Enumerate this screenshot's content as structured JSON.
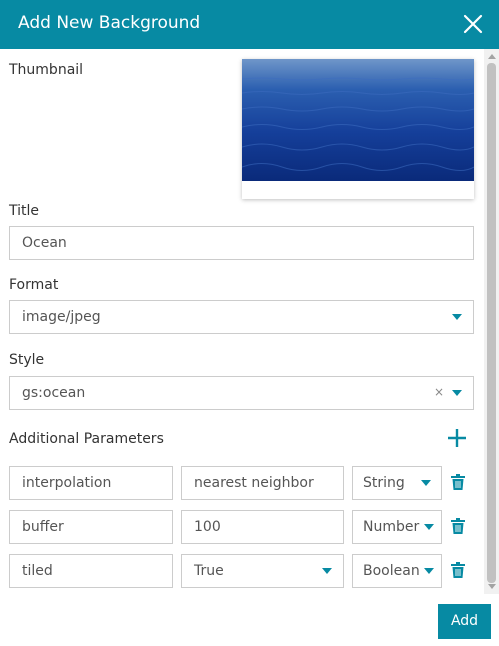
{
  "dialog": {
    "title": "Add New Background",
    "close_icon": "close-icon"
  },
  "thumbnail": {
    "label": "Thumbnail",
    "image": "ocean water photo"
  },
  "title_field": {
    "label": "Title",
    "value": "Ocean"
  },
  "format_field": {
    "label": "Format",
    "value": "image/jpeg"
  },
  "style_field": {
    "label": "Style",
    "value": "gs:ocean",
    "clear": "×"
  },
  "params": {
    "label": "Additional Parameters",
    "rows": [
      {
        "key": "interpolation",
        "value": "nearest neighbor",
        "type": "String",
        "value_is_select": false
      },
      {
        "key": "buffer",
        "value": "100",
        "type": "Number",
        "value_is_select": false
      },
      {
        "key": "tiled",
        "value": "True",
        "type": "Boolean",
        "value_is_select": true
      }
    ]
  },
  "footer": {
    "add_label": "Add"
  },
  "colors": {
    "accent": "#078aa3",
    "border": "#cccccc"
  }
}
